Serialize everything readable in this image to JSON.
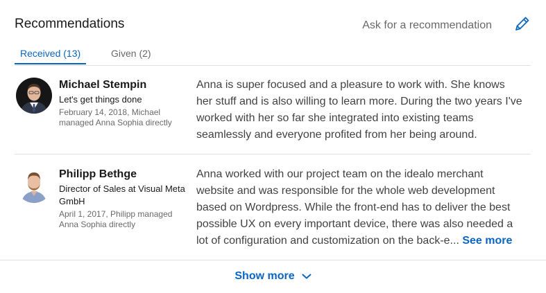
{
  "section": {
    "title": "Recommendations",
    "ask_label": "Ask for a recommendation",
    "edit_icon": "pencil-icon"
  },
  "tabs": [
    {
      "label": "Received (13)",
      "active": true
    },
    {
      "label": "Given (2)",
      "active": false
    }
  ],
  "recommendations": [
    {
      "name": "Michael Stempin",
      "headline": "Let's get things done",
      "meta": "February 14, 2018, Michael managed Anna Sophia directly",
      "text": "Anna is super focused and a pleasure to work with. She knows her stuff and is also willing to learn more. During the two years I've worked with her so far she integrated into existing teams seamlessly and everyone profited from her being around."
    },
    {
      "name": "Philipp Bethge",
      "headline": "Director of Sales at Visual Meta GmbH",
      "meta": "April 1, 2017, Philipp managed Anna Sophia directly",
      "text": "Anna worked with our project team on the idealo merchant website and was responsible for the whole web development based on Wordpress. While the front-end has to deliver the best possible UX on every important device, there was also needed a lot of configuration and customization on the back-e...",
      "see_more_label": "See more"
    }
  ],
  "footer": {
    "show_more_label": "Show more",
    "chevron_icon": "chevron-down-icon"
  },
  "colors": {
    "accent": "#0a66c2",
    "divider": "#e0e0e0"
  }
}
